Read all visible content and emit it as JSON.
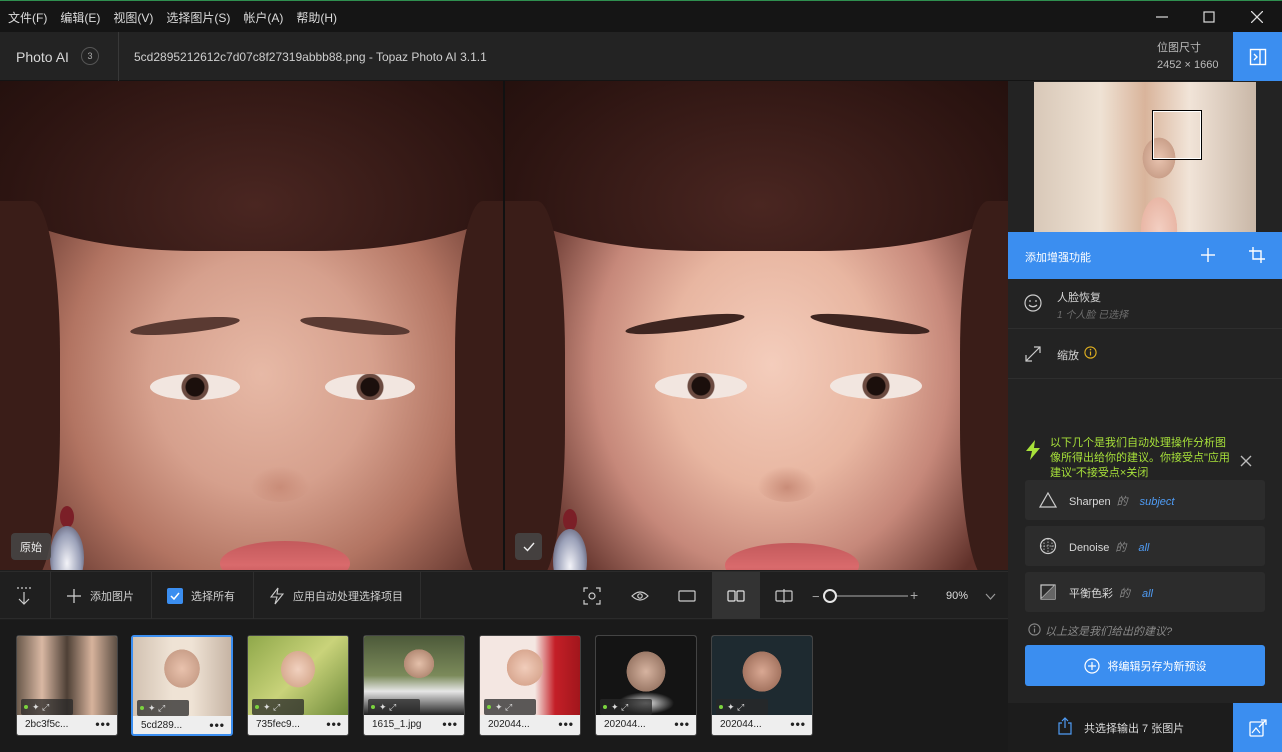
{
  "menu": {
    "items": [
      "文件(F)",
      "编辑(E)",
      "视图(V)",
      "选择图片(S)",
      "帐户(A)",
      "帮助(H)"
    ]
  },
  "window": {
    "minimize_icon": "minimize-icon",
    "maximize_icon": "maximize-icon",
    "close_icon": "close-icon"
  },
  "header": {
    "app_name": "Photo AI",
    "image_count": "3",
    "file_title": "5cd2895212612c7d07c8f27319abbb88.png - Topaz Photo AI 3.1.1",
    "dim_label": "位图尺寸",
    "dim_value": "2452 × 1660"
  },
  "canvas": {
    "original_badge": "原始"
  },
  "toolbar": {
    "add_image": "添加图片",
    "select_all": "选择所有",
    "select_all_checked": true,
    "apply_autopilot": "应用自动处理选择项目",
    "zoom": "90%",
    "zoom_fraction": 0.05
  },
  "thumbnails": [
    {
      "name": "2bc3f5c...",
      "selected": false
    },
    {
      "name": "5cd289...",
      "selected": true
    },
    {
      "name": "735fec9...",
      "selected": false
    },
    {
      "name": "1615_1.jpg",
      "selected": false
    },
    {
      "name": "202044...",
      "selected": false
    },
    {
      "name": "202044...",
      "selected": false
    },
    {
      "name": "202044...",
      "selected": false
    }
  ],
  "panel": {
    "enhance_label": "添加增强功能",
    "face_recovery": {
      "title": "人脸恢复",
      "sub": "1 个人脸 已选择"
    },
    "upscale": {
      "title": "缩放"
    },
    "suggestion": "以下几个是我们自动处理操作分析图像所得出给你的建议。你接受点\"应用建议\"不接受点×关闭",
    "suggestions": [
      {
        "label": "Sharpen",
        "of": "的",
        "target": "subject"
      },
      {
        "label": "Denoise",
        "of": "的",
        "target": "all"
      },
      {
        "label": "平衡色彩",
        "of": "的",
        "target": "all"
      }
    ],
    "footer": "以上这是我们给出的建议?",
    "save_preset": "将编辑另存为新预设",
    "export_label": "共选择输出 7 张图片"
  },
  "colors": {
    "accent": "#3b8ef0",
    "suggestion_text": "#a8e23a"
  }
}
